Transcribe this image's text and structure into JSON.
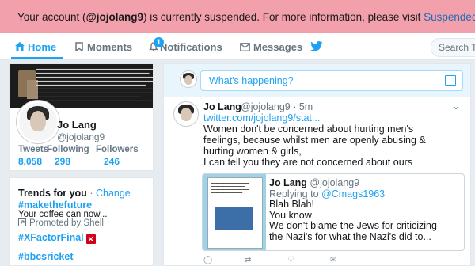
{
  "banner": {
    "prefix": "Your account (",
    "handle": "@jojolang9",
    "suffix": ") is currently suspended. For more information, please visit ",
    "link": "Suspended Acc"
  },
  "nav": {
    "home": "Home",
    "moments": "Moments",
    "notifications": "Notifications",
    "notification_count": "1",
    "messages": "Messages",
    "search_placeholder": "Search T"
  },
  "profile": {
    "name": "Jo Lang",
    "handle": "@jojolang9",
    "stats": [
      {
        "label": "Tweets",
        "value": "8,058"
      },
      {
        "label": "Following",
        "value": "298"
      },
      {
        "label": "Followers",
        "value": "246"
      }
    ]
  },
  "trends": {
    "title": "Trends for you",
    "separator": "·",
    "change": "Change",
    "items": [
      {
        "tag": "#makethefuture",
        "sub": "Your coffee can now..."
      },
      {
        "promoted": "Promoted by Shell"
      },
      {
        "tag": "#XFactorFinal"
      },
      {
        "tag": "#bbcsricket"
      }
    ]
  },
  "compose": {
    "placeholder": "What's happening?"
  },
  "tweet": {
    "name": "Jo Lang",
    "handle": "@jojolang9 · 5m",
    "link": "twitter.com/jojolang9/stat...",
    "lines": [
      "Women don't be concerned about hurting men's",
      "feelings, because whilst men are openly abusing &",
      "hurting women & girls,",
      "I can tell you they are not concerned about ours"
    ],
    "quote": {
      "name": "Jo Lang",
      "handle": "@jojolang9",
      "reply_prefix": "Replying to",
      "reply_user": "@Cmags1963",
      "lines": [
        "Blah Blah!",
        "You know",
        "We don't blame the Jews for criticizing",
        "the Nazi's for what the Nazi's did to..."
      ]
    }
  },
  "colors": {
    "banner_bg": "#f3a0ad",
    "accent": "#1da1f2",
    "page_bg": "#e6ecf0"
  }
}
